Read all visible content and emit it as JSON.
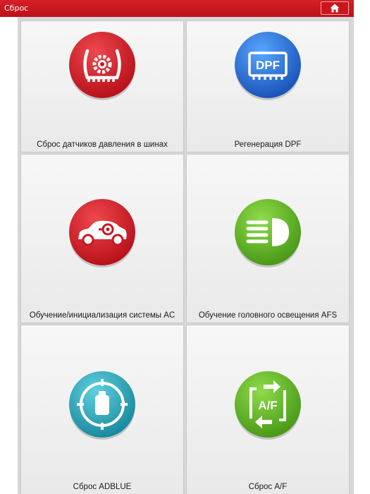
{
  "header": {
    "title": "Сброс"
  },
  "tiles": [
    {
      "label": "Сброс датчиков давления в шинах",
      "icon": "tire-pressure-icon",
      "color": "#d3232b"
    },
    {
      "label": "Регенерация DPF",
      "icon": "dpf-icon",
      "badge": "DPF",
      "color": "#2a6fd6"
    },
    {
      "label": "Обучение/инициализация системы AC",
      "icon": "car-ac-icon",
      "color": "#d3232b"
    },
    {
      "label": "Обучение головного освещения AFS",
      "icon": "headlight-icon",
      "color": "#6ab82a"
    },
    {
      "label": "Сброс ADBLUE",
      "icon": "adblue-icon",
      "color": "#2aa3b8"
    },
    {
      "label": "Сброс A/F",
      "icon": "air-fuel-icon",
      "badge": "A/F",
      "color": "#6ab82a"
    }
  ]
}
